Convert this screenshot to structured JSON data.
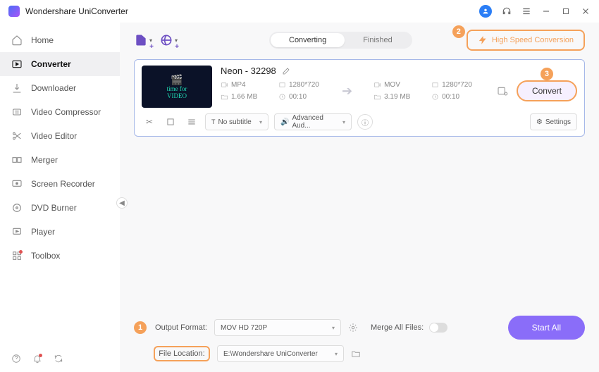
{
  "app_title": "Wondershare UniConverter",
  "sidebar": {
    "items": [
      {
        "label": "Home",
        "icon": "home"
      },
      {
        "label": "Converter",
        "icon": "converter"
      },
      {
        "label": "Downloader",
        "icon": "download"
      },
      {
        "label": "Video Compressor",
        "icon": "compress"
      },
      {
        "label": "Video Editor",
        "icon": "edit"
      },
      {
        "label": "Merger",
        "icon": "merge"
      },
      {
        "label": "Screen Recorder",
        "icon": "record"
      },
      {
        "label": "DVD Burner",
        "icon": "burn"
      },
      {
        "label": "Player",
        "icon": "play"
      },
      {
        "label": "Toolbox",
        "icon": "tools"
      }
    ],
    "active_index": 1
  },
  "tabs": {
    "items": [
      "Converting",
      "Finished"
    ],
    "active_index": 0
  },
  "high_speed_label": "High Speed Conversion",
  "annotations": {
    "badge1": "1",
    "badge2": "2",
    "badge3": "3"
  },
  "file": {
    "name": "Neon - 32298",
    "thumb_text": "time for\nVIDEO",
    "src": {
      "format": "MP4",
      "resolution": "1280*720",
      "size": "1.66 MB",
      "duration": "00:10"
    },
    "dst": {
      "format": "MOV",
      "resolution": "1280*720",
      "size": "3.19 MB",
      "duration": "00:10"
    },
    "subtitle": "No subtitle",
    "audio": "Advanced Aud...",
    "settings_label": "Settings",
    "convert_label": "Convert"
  },
  "bottom": {
    "output_format_label": "Output Format:",
    "output_format_value": "MOV HD 720P",
    "file_location_label": "File Location:",
    "file_location_value": "E:\\Wondershare UniConverter",
    "merge_label": "Merge All Files:",
    "start_all": "Start All"
  }
}
